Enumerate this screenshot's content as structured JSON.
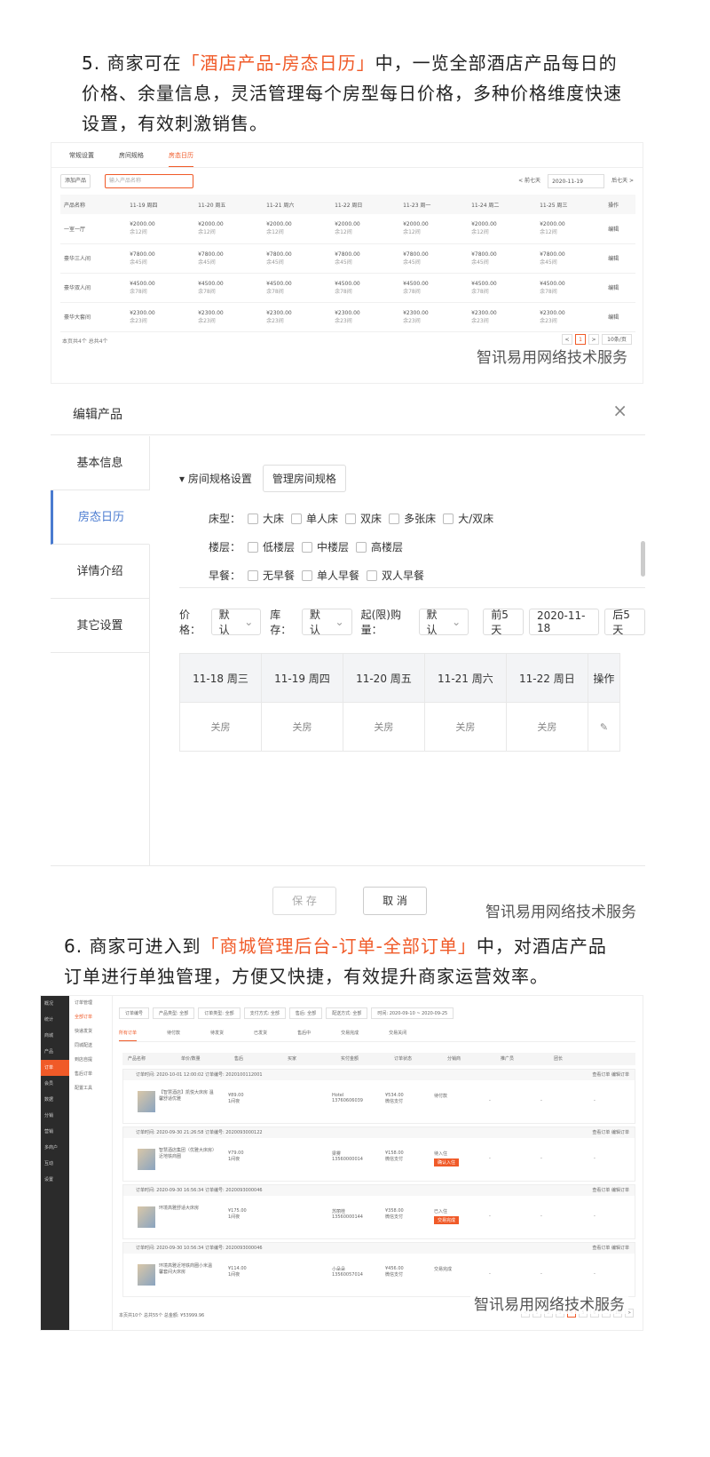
{
  "para1": {
    "prefix": "5. 商家可在",
    "highlight": "「酒店产品-房态日历」",
    "suffix": "中，一览全部酒店产品每日的价格、余量信息，灵活管理每个房型每日价格，多种价格维度快速设置，有效刺激销售。"
  },
  "para2": {
    "prefix": "6. 商家可进入到",
    "highlight": "「商城管理后台-订单-全部订单」",
    "suffix": "中，对酒店产品订单进行单独管理，方便又快捷，有效提升商家运营效率。"
  },
  "watermark": "智讯易用网络技术服务",
  "calendar": {
    "tabs": [
      "常规设置",
      "房间规格",
      "房态日历"
    ],
    "add_button": "添加产品",
    "search_placeholder": "输入产品名称",
    "prev": "< 前七天",
    "date": "2020-11-19",
    "next": "后七天 >",
    "headers": [
      "产品名称",
      "11-19 周四",
      "11-20 周五",
      "11-21 周六",
      "11-22 周日",
      "11-23 周一",
      "11-24 周二",
      "11-25 周三",
      "操作"
    ],
    "rows": [
      {
        "name": "一室一厅",
        "price": "¥2000.00",
        "stock": "余12间",
        "op": "编辑"
      },
      {
        "name": "豪华三人间",
        "price": "¥7800.00",
        "stock": "余45间",
        "op": "编辑"
      },
      {
        "name": "豪华双人间",
        "price": "¥4500.00",
        "stock": "余78间",
        "op": "编辑"
      },
      {
        "name": "豪华大套间",
        "price": "¥2300.00",
        "stock": "余23间",
        "op": "编辑"
      }
    ],
    "footer": "本页共4个 总共4个",
    "pager": [
      "<",
      "1",
      ">",
      "10条/页"
    ]
  },
  "editor": {
    "title": "编辑产品",
    "close": "×",
    "sidebar": [
      "基本信息",
      "房态日历",
      "详情介绍",
      "其它设置"
    ],
    "spec_label": "▾ 房间规格设置",
    "manage_button": "管理房间规格",
    "bed_label": "床型：",
    "beds": [
      "大床",
      "单人床",
      "双床",
      "多张床",
      "大/双床"
    ],
    "floor_label": "楼层：",
    "floors": [
      "低楼层",
      "中楼层",
      "高楼层"
    ],
    "breakfast_label": "早餐：",
    "breakfasts": [
      "无早餐",
      "单人早餐",
      "双人早餐"
    ],
    "price_label": "价格：",
    "price_sel": "默认",
    "stock_label": "库存：",
    "stock_sel": "默认",
    "limit_label": "起(限)购量：",
    "limit_sel": "默认",
    "prev5": "前5天",
    "date": "2020-11-18",
    "next5": "后5天",
    "days": [
      "11-18 周三",
      "11-19 周四",
      "11-20 周五",
      "11-21 周六",
      "11-22 周日",
      "操作"
    ],
    "cells": [
      "关房",
      "关房",
      "关房",
      "关房",
      "关房",
      "✎"
    ],
    "save": "保 存",
    "cancel": "取 消"
  },
  "orders": {
    "nav": [
      "概况",
      "统计",
      "商城",
      "产品",
      "订单",
      "会员",
      "数据",
      "分销",
      "营销",
      "多商户",
      "互动",
      "设置"
    ],
    "subnav": [
      "订单管理",
      "全部订单",
      "快递发货",
      "同城配送",
      "到店自提",
      "售后订单",
      "配置工具"
    ],
    "filters": [
      "订单编号",
      "产品类型: 全部",
      "订单类型: 全部",
      "支付方式: 全部",
      "售后: 全部",
      "配送方式: 全部",
      "时间: 2020-09-10 ~ 2020-09-25"
    ],
    "tabs": [
      "所有订单",
      "待付款",
      "待发货",
      "已发货",
      "售后中",
      "交易完成",
      "交易关闭"
    ],
    "cols": [
      "产品名称",
      "单价/数量",
      "售后",
      "买家",
      "实付金额",
      "订单状态",
      "分销商",
      "推广员",
      "团长"
    ],
    "list": [
      {
        "top": "订单时间: 2020-10-01 12:00:02 订单编号: 2020100112001",
        "name": "【智慧酒店】凯悦大床房 温馨舒适优雅",
        "price": "¥89.00",
        "qty": "1间夜",
        "buyer": "Hotel",
        "phone": "13760606039",
        "amount": "¥534.00",
        "pay": "微信支付",
        "status": "待付款",
        "tag": ""
      },
      {
        "top": "订单时间: 2020-09-30 21:26:58 订单编号: 2020093000122",
        "name": "智慧酒店集团（优雅大床房）近地铁商圈",
        "price": "¥79.00",
        "qty": "1间夜",
        "buyer": "梁雾",
        "phone": "13560000014",
        "amount": "¥158.00",
        "pay": "微信支付",
        "status": "待入住",
        "tag": "确认入住"
      },
      {
        "top": "订单时间: 2020-09-30 16:56:34 订单编号: 2020093000046",
        "name": "环境高雅舒适大床房",
        "price": "¥175.00",
        "qty": "1间夜",
        "buyer": "苏丽桂",
        "phone": "13560000144",
        "amount": "¥358.00",
        "pay": "微信支付",
        "status": "已入住",
        "tag": "交易完成"
      },
      {
        "top": "订单时间: 2020-09-30 10:56:34 订单编号: 2020093000046",
        "name": "环境高雅近地铁商圈小米温馨套间大床房",
        "price": "¥114.00",
        "qty": "1间夜",
        "buyer": "小朵朵",
        "phone": "13560057014",
        "amount": "¥456.00",
        "pay": "微信支付",
        "status": "交易完成",
        "tag": ""
      }
    ],
    "ops": "查看订单  编辑订单",
    "summary": "本页共10个 总共55个 总金额: ¥53999.96",
    "pager": [
      "<",
      "1",
      "2",
      "3",
      "4",
      "5",
      "6",
      "...",
      "10",
      ">"
    ]
  }
}
